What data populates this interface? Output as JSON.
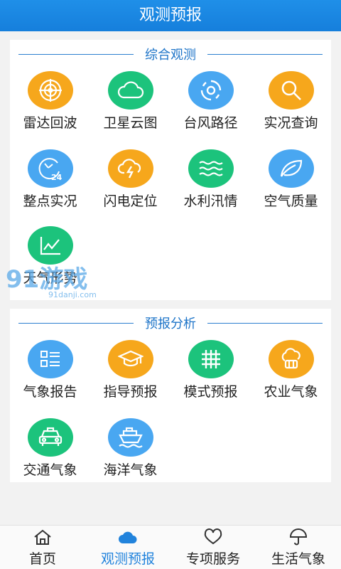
{
  "header": {
    "title": "观测预报"
  },
  "colors": {
    "orange": "#f6a71c",
    "green": "#1cc37c",
    "blue": "#49a7f1",
    "accent": "#2183dc"
  },
  "section1": {
    "title": "综合观测",
    "items": [
      {
        "label": "雷达回波",
        "icon": "radar-icon",
        "color": "orange"
      },
      {
        "label": "卫星云图",
        "icon": "cloud-icon",
        "color": "green"
      },
      {
        "label": "台风路径",
        "icon": "typhoon-icon",
        "color": "blue"
      },
      {
        "label": "实况查询",
        "icon": "search-icon",
        "color": "orange"
      },
      {
        "label": "整点实况",
        "icon": "clock-24-icon",
        "color": "blue"
      },
      {
        "label": "闪电定位",
        "icon": "lightning-cloud-icon",
        "color": "orange"
      },
      {
        "label": "水利汛情",
        "icon": "water-waves-icon",
        "color": "green"
      },
      {
        "label": "空气质量",
        "icon": "leaf-icon",
        "color": "blue"
      },
      {
        "label": "天气形势",
        "icon": "trend-chart-icon",
        "color": "green"
      }
    ]
  },
  "section2": {
    "title": "预报分析",
    "items": [
      {
        "label": "气象报告",
        "icon": "report-list-icon",
        "color": "blue"
      },
      {
        "label": "指导预报",
        "icon": "graduation-cap-icon",
        "color": "orange"
      },
      {
        "label": "模式预报",
        "icon": "grid-icon",
        "color": "green"
      },
      {
        "label": "农业气象",
        "icon": "farm-icon",
        "color": "orange"
      },
      {
        "label": "交通气象",
        "icon": "car-icon",
        "color": "green"
      },
      {
        "label": "海洋气象",
        "icon": "ship-icon",
        "color": "blue"
      }
    ]
  },
  "watermark": {
    "main": "91游戏",
    "sub": "91danji.com"
  },
  "nav": {
    "items": [
      {
        "label": "首页",
        "icon": "home-icon"
      },
      {
        "label": "观测预报",
        "icon": "cloud-icon"
      },
      {
        "label": "专项服务",
        "icon": "heart-icon"
      },
      {
        "label": "生活气象",
        "icon": "umbrella-icon"
      }
    ],
    "active": "观测预报"
  }
}
